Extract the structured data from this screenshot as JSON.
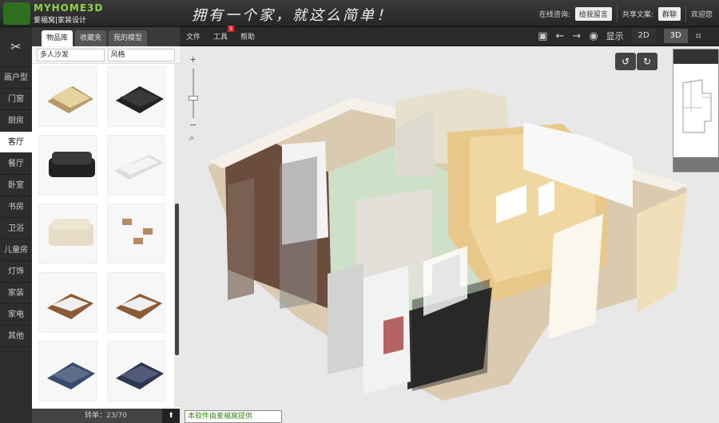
{
  "header": {
    "logo_text": "MYHOME3D",
    "logo_sub": "爱福窝|家装设计",
    "slogan": "拥有一个家，就这么简单！",
    "online_help_label": "在线咨询:",
    "online_help_button": "给我留言",
    "share_label": "共享文案:",
    "share_button": "群聊",
    "user_name": "欢迎您"
  },
  "left_categories": [
    {
      "label": "画户型"
    },
    {
      "label": "门窗"
    },
    {
      "label": "厨房"
    },
    {
      "label": "客厅"
    },
    {
      "label": "餐厅"
    },
    {
      "label": "卧室"
    },
    {
      "label": "书房"
    },
    {
      "label": "卫浴"
    },
    {
      "label": "儿童房"
    },
    {
      "label": "灯饰"
    },
    {
      "label": "家装"
    },
    {
      "label": "家电"
    },
    {
      "label": "其他"
    }
  ],
  "panel": {
    "tabs": [
      "物品库",
      "收藏夹",
      "我的模型"
    ],
    "active_tab": "物品库",
    "filter_1": "多人沙发",
    "filter_2": "风格",
    "footer": "转单：23/70"
  },
  "toolbar": {
    "menu_file": "文件",
    "menu_tools": "工具",
    "menu_tools_badge": "3",
    "menu_help": "帮助",
    "display_label": "显示",
    "view_2d": "2D",
    "view_3d": "3D"
  },
  "canvas": {
    "credit": "本软件由爱福窝提供"
  },
  "colors": {
    "accent_green": "#8fd14a",
    "dark_bg": "#1b1b1b",
    "canvas_bg": "#e8e8e8"
  }
}
